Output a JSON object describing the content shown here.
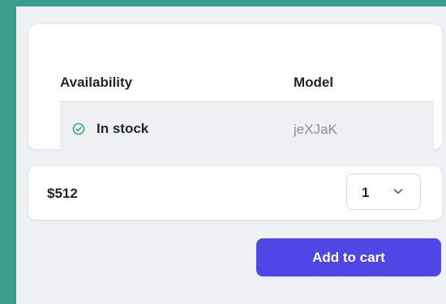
{
  "product": {
    "headers": {
      "availability": "Availability",
      "model": "Model"
    },
    "availability": "In stock",
    "model": "jeXJaK",
    "price": "$512",
    "quantity": "1",
    "add_to_cart_label": "Add to cart"
  },
  "colors": {
    "accent": "#4f46e5",
    "in_stock": "#3aa66b",
    "background": "#3a9d8a"
  },
  "icons": {
    "availability": "check-circle-icon",
    "quantity_dropdown": "chevron-down-icon"
  }
}
